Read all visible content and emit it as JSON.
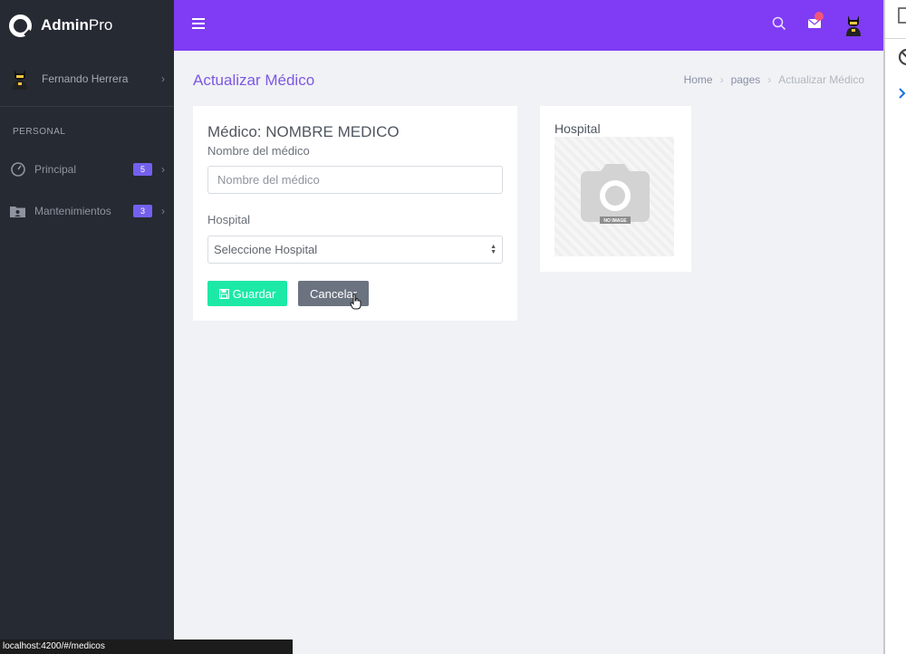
{
  "brand": {
    "name_bold": "Admin",
    "name_light": "Pro"
  },
  "user": {
    "name": "Fernando Herrera"
  },
  "sidebar": {
    "section_label": "PERSONAL",
    "items": [
      {
        "label": "Principal",
        "badge": "5",
        "icon": "gauge-icon"
      },
      {
        "label": "Mantenimientos",
        "badge": "3",
        "icon": "folder-user-icon"
      }
    ]
  },
  "topbar": {
    "icons": [
      "menu-icon",
      "search-icon",
      "mail-icon",
      "avatar"
    ]
  },
  "page": {
    "title": "Actualizar Médico",
    "breadcrumb": [
      "Home",
      "pages",
      "Actualizar Médico"
    ]
  },
  "form": {
    "title": "Médico: NOMBRE MEDICO",
    "name_label": "Nombre del médico",
    "name_placeholder": "Nombre del médico",
    "name_value": "",
    "hospital_label": "Hospital",
    "hospital_selected": "Seleccione Hospital",
    "save_label": "Guardar",
    "cancel_label": "Cancelar"
  },
  "hospital_card": {
    "title": "Hospital",
    "image_text": "NO IMAGE"
  },
  "statusbar": {
    "url": "localhost:4200/#/medicos"
  },
  "colors": {
    "topbar": "#7f3cf4",
    "sidebar": "#262a33",
    "badge": "#7460ee",
    "save": "#1de9a6",
    "cancel": "#6c7380",
    "title": "#7e57e2"
  }
}
